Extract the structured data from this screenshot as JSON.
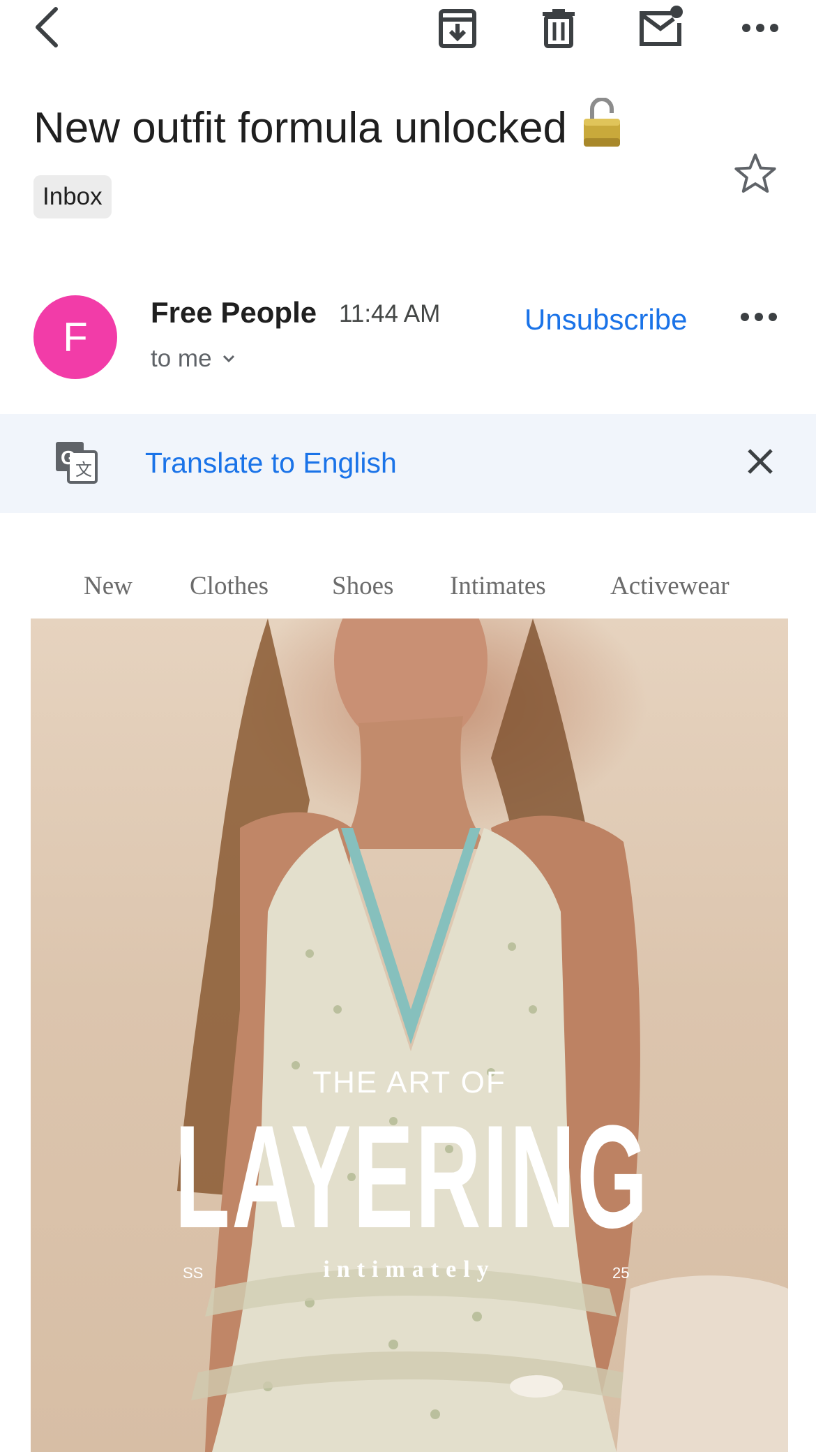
{
  "toolbar": {
    "back_icon": "back-arrow-icon",
    "archive_icon": "archive-icon",
    "delete_icon": "trash-icon",
    "mark_unread_icon": "mail-unread-icon",
    "more_icon": "more-horizontal-icon"
  },
  "email": {
    "subject": "New outfit formula unlocked",
    "subject_emoji_icon": "open-lock-icon",
    "label": "Inbox",
    "starred": false
  },
  "sender": {
    "avatar_letter": "F",
    "avatar_color": "#f23ca8",
    "name": "Free People",
    "time": "11:44 AM",
    "recipient": "to me",
    "unsubscribe": "Unsubscribe"
  },
  "translate": {
    "link": "Translate to English",
    "icon": "google-translate-icon"
  },
  "body": {
    "nav": [
      "New",
      "Clothes",
      "Shoes",
      "Intimates",
      "Activewear"
    ],
    "hero": {
      "kicker": "THE ART OF",
      "title": "LAYERING",
      "subtitle": "intimately",
      "left_mark": "SS",
      "right_mark": "25"
    }
  },
  "colors": {
    "link_blue": "#1a73e8",
    "translate_bar_bg": "#f1f5fb",
    "chip_bg": "#ececec"
  }
}
